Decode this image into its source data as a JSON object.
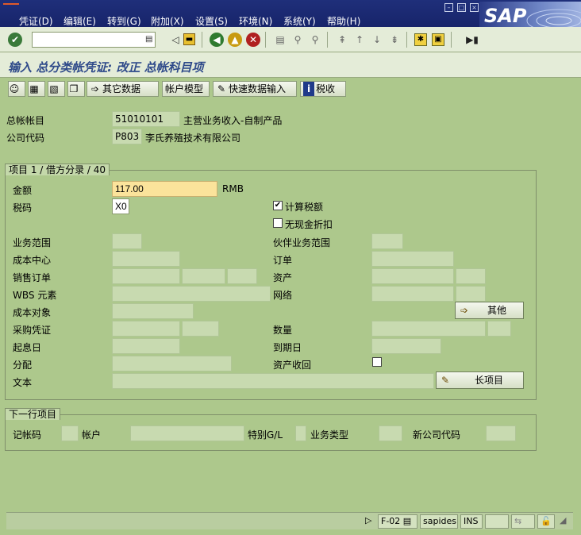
{
  "menu": {
    "items": [
      "凭证(D)",
      "编辑(E)",
      "转到(G)",
      "附加(X)",
      "设置(S)",
      "环境(N)",
      "系统(Y)",
      "帮助(H)"
    ],
    "logo": "SAP"
  },
  "toolbar": {
    "command_field_value": ""
  },
  "title": "输入 总分类帐凭证: 改正 总帐科目项",
  "app_toolbar": {
    "other_data": "其它数据",
    "account_model": "帐户模型",
    "fast_entry": "快速数据输入",
    "tax": "税收"
  },
  "header": {
    "gl_account_label": "总帐帐目",
    "gl_account_value": "51010101",
    "gl_account_desc": "主营业务收入-自制产品",
    "company_code_label": "公司代码",
    "company_code_value": "P803",
    "company_code_desc": "李氏养殖技术有限公司"
  },
  "item_group": {
    "title": "项目 1 / 借方分录 / 40",
    "amount_label": "金额",
    "amount_value": "117.00",
    "currency": "RMB",
    "tax_code_label": "税码",
    "tax_code_value": "X0",
    "calc_tax_label": "计算税额",
    "calc_tax_checked": true,
    "no_cash_discount_label": "无现金折扣",
    "no_cash_discount_checked": false,
    "business_area_label": "业务范围",
    "partner_ba_label": "伙伴业务范围",
    "cost_center_label": "成本中心",
    "order_label": "订单",
    "sales_order_label": "销售订单",
    "asset_label": "资产",
    "wbs_label": "WBS 元素",
    "network_label": "网络",
    "cost_object_label": "成本对象",
    "more_button": "其他",
    "purchase_doc_label": "采购凭证",
    "quantity_label": "数量",
    "value_date_label": "起息日",
    "due_date_label": "到期日",
    "assignment_label": "分配",
    "asset_retirement_label": "资产收回",
    "asset_retirement_checked": false,
    "text_label": "文本",
    "long_text_button": "长项目"
  },
  "next_item": {
    "title": "下一行项目",
    "posting_key_label": "记帐码",
    "account_label": "帐户",
    "special_gl_label": "特别G/L",
    "transaction_type_label": "业务类型",
    "new_company_code_label": "新公司代码"
  },
  "status": {
    "transaction": "F-02",
    "server": "sapides",
    "mode": "INS"
  },
  "icons": {
    "enter": "check-icon",
    "save": "save-icon",
    "back": "back-icon",
    "exit": "exit-icon",
    "cancel": "cancel-icon",
    "print": "print-icon",
    "find": "find-icon",
    "find_next": "find-next-icon",
    "first_page": "first-page-icon",
    "prev_page": "prev-page-icon",
    "next_page": "next-page-icon",
    "last_page": "last-page-icon",
    "new_session": "new-session-icon",
    "shortcut": "shortcut-icon",
    "help": "help-icon"
  },
  "colors": {
    "background": "#adc88c",
    "menubar": "#1f2f7a",
    "edit_field": "#fbe39b",
    "title_text": "#2f4a8a"
  }
}
